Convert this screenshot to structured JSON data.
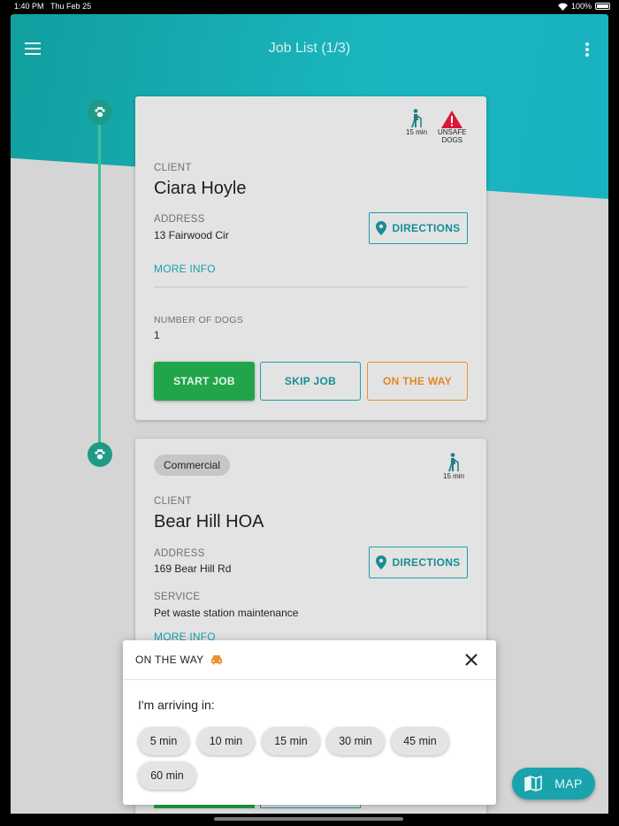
{
  "status_bar": {
    "time": "1:40 PM",
    "date": "Thu Feb 25",
    "battery": "100%"
  },
  "header": {
    "title": "Job List (1/3)"
  },
  "jobs": [
    {
      "badges": [
        {
          "icon": "walker-icon",
          "label": "15 min"
        },
        {
          "icon": "warning-icon",
          "label_line1": "UNSAFE",
          "label_line2": "DOGS"
        }
      ],
      "client_label": "CLIENT",
      "client_name": "Ciara Hoyle",
      "address_label": "ADDRESS",
      "address": "13 Fairwood Cir",
      "directions_label": "DIRECTIONS",
      "more_info_label": "MORE INFO",
      "dogs_label": "NUMBER OF DOGS",
      "dogs_value": "1",
      "start_label": "START JOB",
      "skip_label": "SKIP JOB",
      "on_the_way_label": "ON THE WAY"
    },
    {
      "tag": "Commercial",
      "badges": [
        {
          "icon": "walker-icon",
          "label": "15 min"
        }
      ],
      "client_label": "CLIENT",
      "client_name": "Bear Hill HOA",
      "address_label": "ADDRESS",
      "address": "169 Bear Hill Rd",
      "directions_label": "DIRECTIONS",
      "service_label": "SERVICE",
      "service": "Pet waste station maintenance",
      "more_info_label": "MORE INFO"
    }
  ],
  "modal": {
    "title": "ON THE WAY",
    "prompt": "I'm arriving in:",
    "options": [
      "5 min",
      "10 min",
      "15 min",
      "30 min",
      "45 min",
      "60 min"
    ]
  },
  "map_button": {
    "label": "MAP"
  },
  "colors": {
    "teal": "#1ba0a8",
    "green": "#21a54a",
    "orange": "#e9932d",
    "warning_red": "#d9163a"
  }
}
